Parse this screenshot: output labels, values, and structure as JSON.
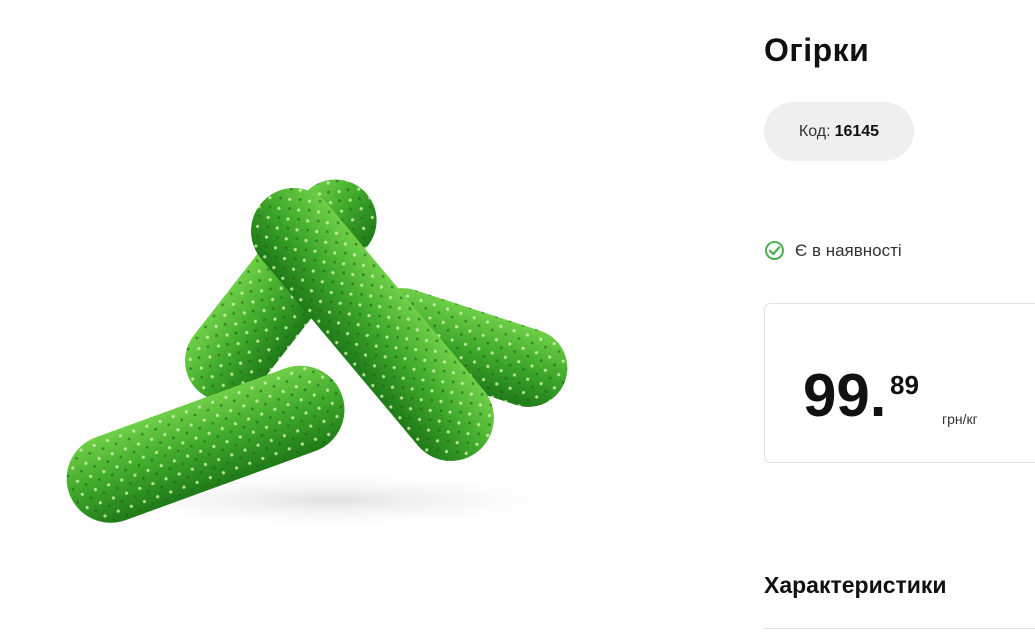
{
  "product": {
    "title": "Огірки",
    "code_label": "Код:",
    "code_value": "16145",
    "availability": "Є в наявності",
    "price_whole": "99.",
    "price_cents": "89",
    "price_unit": "грн/кг",
    "image_icon": "cucumbers-photo"
  },
  "sections": {
    "characteristics": "Характеристики"
  },
  "colors": {
    "availability_check": "#4caf50",
    "pill_background": "#efefef",
    "cucumber_green": "#3fa82a"
  }
}
